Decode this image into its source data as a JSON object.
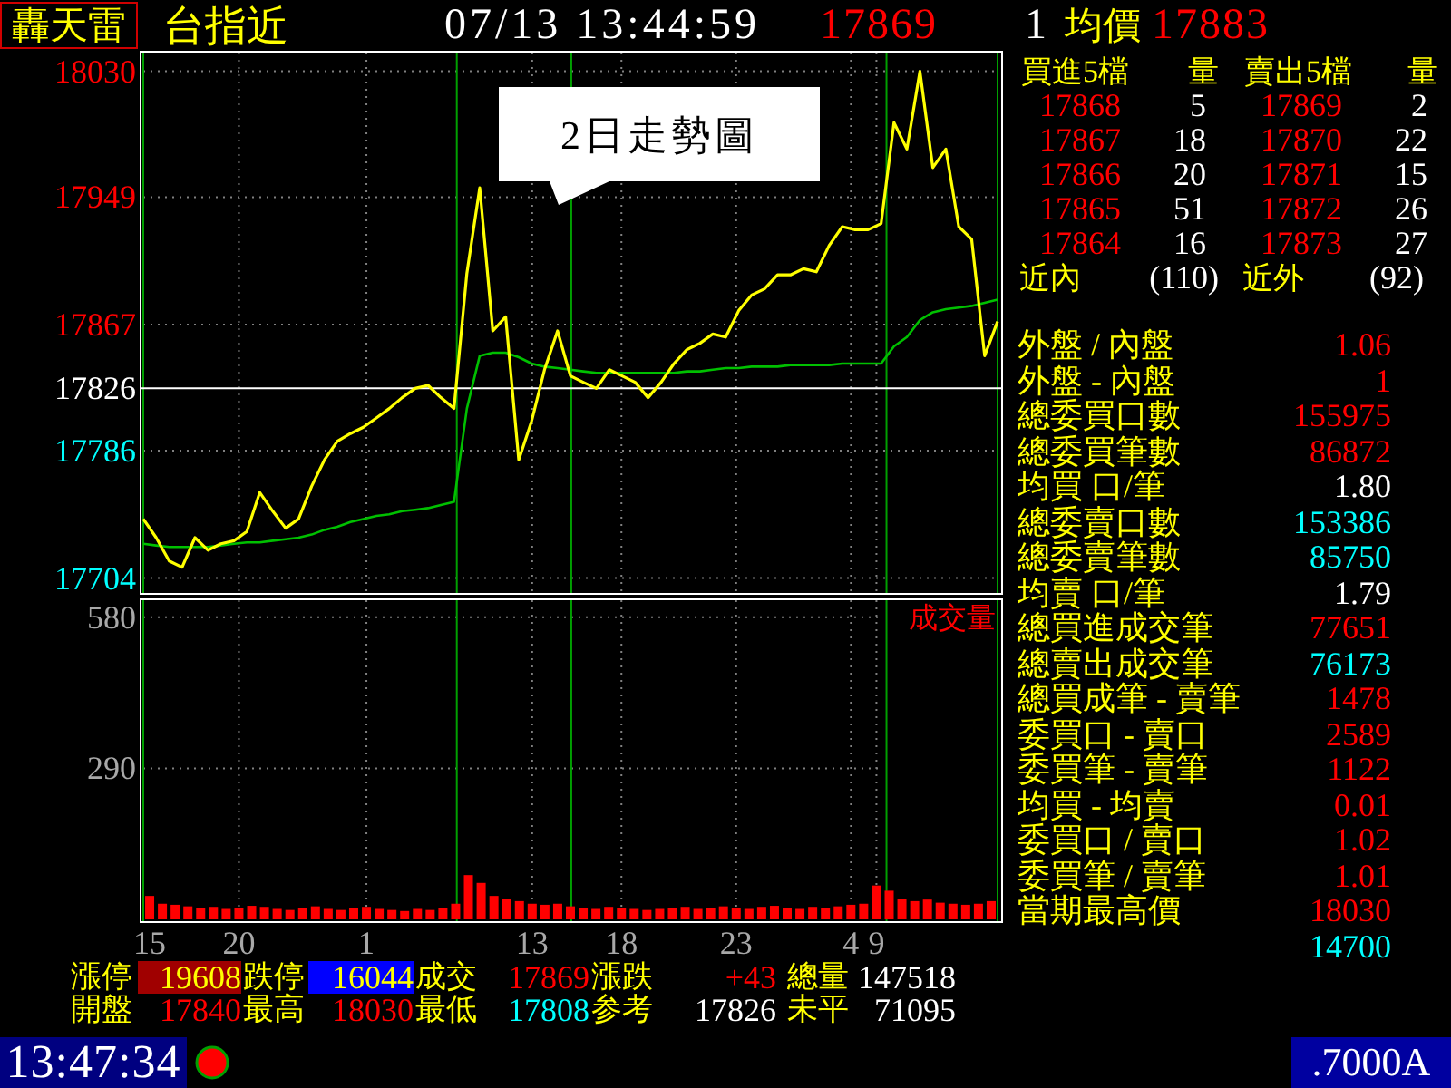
{
  "header": {
    "brand": "轟天雷",
    "symbol": "台指近",
    "datetime": "07/13 13:44:59",
    "last": {
      "text": "17869",
      "kind": "up"
    },
    "tick_volume": "1",
    "avg_label": "均價",
    "avg": {
      "text": "17883",
      "kind": "up"
    }
  },
  "price_chart": {
    "chart_data": {
      "type": "line",
      "title": "2日走勢圖",
      "grid": true,
      "ylim": [
        17695,
        18042
      ],
      "yticks": [
        {
          "value": 18030,
          "label": "18030"
        },
        {
          "value": 17949,
          "label": "17949"
        },
        {
          "value": 17867,
          "label": "17867"
        },
        {
          "value": 17826,
          "label": "17826"
        },
        {
          "value": 17786,
          "label": "17786"
        },
        {
          "value": 17704,
          "label": "17704"
        }
      ],
      "series": [
        {
          "color": "#ffff00",
          "values": [
            17742,
            17730,
            17715,
            17711,
            17730,
            17722,
            17726,
            17728,
            17734,
            17759,
            17747,
            17736,
            17742,
            17763,
            17780,
            17792,
            17797,
            17801,
            17807,
            17813,
            17820,
            17826,
            17828,
            17820,
            17813,
            17900,
            17955,
            17863,
            17872,
            17780,
            17805,
            17838,
            17863,
            17834,
            17830,
            17826,
            17838,
            17834,
            17830,
            17820,
            17830,
            17842,
            17851,
            17855,
            17861,
            17859,
            17876,
            17886,
            17890,
            17899,
            17899,
            17903,
            17901,
            17918,
            17930,
            17928,
            17928,
            17932,
            17997,
            17980,
            18030,
            17968,
            17980,
            17930,
            17922,
            17847,
            17869
          ]
        },
        {
          "color": "#00c000",
          "values": [
            17726,
            17725,
            17724,
            17724,
            17724,
            17724,
            17725,
            17726,
            17727,
            17727,
            17728,
            17729,
            17730,
            17732,
            17735,
            17737,
            17740,
            17742,
            17744,
            17745,
            17747,
            17748,
            17749,
            17751,
            17753,
            17813,
            17847,
            17849,
            17849,
            17846,
            17842,
            17840,
            17839,
            17838,
            17837,
            17836,
            17836,
            17836,
            17836,
            17836,
            17836,
            17836,
            17837,
            17837,
            17838,
            17839,
            17839,
            17840,
            17840,
            17840,
            17841,
            17841,
            17841,
            17841,
            17842,
            17842,
            17842,
            17842,
            17853,
            17859,
            17870,
            17875,
            17877,
            17878,
            17879,
            17881,
            17883
          ]
        }
      ],
      "ref_lines": [
        {
          "axis": "y",
          "value": 17826
        }
      ]
    }
  },
  "volume_chart": {
    "chart_data": {
      "type": "bar",
      "title": "成交量",
      "grid": true,
      "categories": [
        "15",
        null,
        null,
        null,
        null,
        null,
        null,
        "20",
        null,
        null,
        null,
        null,
        null,
        null,
        null,
        null,
        null,
        "1",
        null,
        null,
        null,
        null,
        null,
        null,
        null,
        null,
        null,
        null,
        null,
        null,
        "13",
        null,
        null,
        null,
        null,
        null,
        null,
        "18",
        null,
        null,
        null,
        null,
        null,
        null,
        null,
        null,
        "23",
        null,
        null,
        null,
        null,
        null,
        null,
        null,
        null,
        "4",
        null,
        "9",
        null,
        null,
        null,
        null,
        null,
        null,
        null,
        null,
        null
      ],
      "ylim": [
        0,
        611
      ],
      "yticks": [
        {
          "value": 290,
          "label": "290"
        },
        {
          "value": 580,
          "label": "580"
        }
      ],
      "series": [
        {
          "color": "#ff0000",
          "values": [
            45,
            30,
            28,
            25,
            22,
            24,
            20,
            22,
            26,
            24,
            20,
            18,
            22,
            25,
            20,
            18,
            22,
            24,
            20,
            18,
            16,
            20,
            18,
            22,
            30,
            85,
            70,
            45,
            40,
            35,
            30,
            28,
            30,
            25,
            22,
            20,
            24,
            22,
            20,
            18,
            20,
            22,
            24,
            20,
            22,
            25,
            22,
            20,
            24,
            26,
            22,
            20,
            24,
            22,
            25,
            28,
            30,
            65,
            55,
            40,
            35,
            38,
            32,
            30,
            28,
            30,
            35
          ]
        }
      ]
    }
  },
  "quote_rows": [
    [
      {
        "label": "漲停",
        "value": "19608",
        "kind": "limitup"
      },
      {
        "label": "跌停",
        "value": "16044",
        "kind": "limitdown"
      },
      {
        "label": "成交",
        "value": "17869",
        "kind": "up"
      },
      {
        "label": "漲跌",
        "value": "+43",
        "kind": "up"
      },
      {
        "label": "總量",
        "value": "147518",
        "kind": "neutral"
      }
    ],
    [
      {
        "label": "開盤",
        "value": "17840",
        "kind": "up"
      },
      {
        "label": "最高",
        "value": "18030",
        "kind": "up"
      },
      {
        "label": "最低",
        "value": "17808",
        "kind": "down"
      },
      {
        "label": "参考",
        "value": "17826",
        "kind": "neutral"
      },
      {
        "label": "未平",
        "value": "71095",
        "kind": "neutral"
      }
    ]
  ],
  "order_book": {
    "bid_heading": "買進5檔",
    "bid_qty_heading": "量",
    "ask_heading": "賣出5檔",
    "ask_qty_heading": "量",
    "levels": [
      {
        "bid": "17868",
        "bid_qty": "5",
        "ask": "17869",
        "ask_qty": "2"
      },
      {
        "bid": "17867",
        "bid_qty": "18",
        "ask": "17870",
        "ask_qty": "22"
      },
      {
        "bid": "17866",
        "bid_qty": "20",
        "ask": "17871",
        "ask_qty": "15"
      },
      {
        "bid": "17865",
        "bid_qty": "51",
        "ask": "17872",
        "ask_qty": "26"
      },
      {
        "bid": "17864",
        "bid_qty": "16",
        "ask": "17873",
        "ask_qty": "27"
      }
    ],
    "inner_label": "近內",
    "inner": "(110)",
    "outer_label": "近外",
    "outer": "(92)"
  },
  "stats": [
    {
      "label": "外盤 / 內盤",
      "value": "1.06",
      "color": "#ff0000"
    },
    {
      "label": "外盤 - 內盤",
      "value": "1",
      "color": "#ff0000"
    },
    {
      "label": "總委買口數",
      "value": "155975",
      "color": "#ff0000"
    },
    {
      "label": "總委買筆數",
      "value": "86872",
      "color": "#ff0000"
    },
    {
      "label": "均買 口/筆",
      "value": "1.80",
      "color": "#ffffff"
    },
    {
      "label": "總委賣口數",
      "value": "153386",
      "color": "#00ffff"
    },
    {
      "label": "總委賣筆數",
      "value": "85750",
      "color": "#00ffff"
    },
    {
      "label": "均賣 口/筆",
      "value": "1.79",
      "color": "#ffffff"
    },
    {
      "label": "總買進成交筆",
      "value": "77651",
      "color": "#ff0000"
    },
    {
      "label": "總賣出成交筆",
      "value": "76173",
      "color": "#00ffff"
    },
    {
      "label": "總買成筆 - 賣筆",
      "value": "1478",
      "color": "#ff0000"
    },
    {
      "label": "委買口 - 賣口",
      "value": "2589",
      "color": "#ff0000"
    },
    {
      "label": "委買筆 - 賣筆",
      "value": "1122",
      "color": "#ff0000"
    },
    {
      "label": "均買 - 均賣",
      "value": "0.01",
      "color": "#ff0000"
    },
    {
      "label": "委買口 / 賣口",
      "value": "1.02",
      "color": "#ff0000"
    },
    {
      "label": "委買筆 / 賣筆",
      "value": "1.01",
      "color": "#ff0000"
    },
    {
      "label": "當期最高價",
      "value": "18030",
      "color": "#ff0000"
    },
    {
      "value": "14700",
      "color": "#00ffff"
    }
  ],
  "status_bar": {
    "clock": "13:47:34",
    "code": ".7000A"
  }
}
